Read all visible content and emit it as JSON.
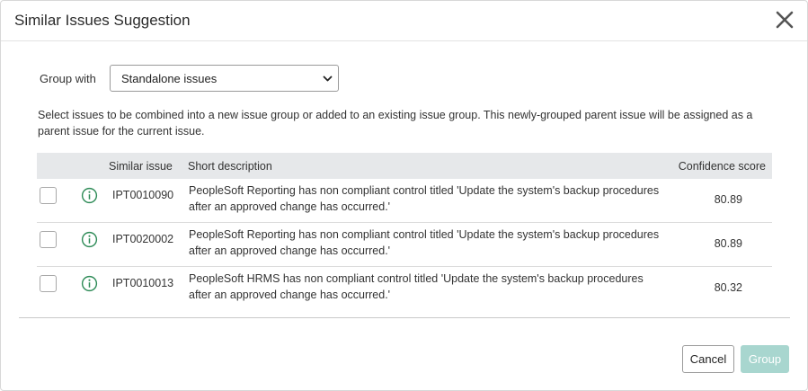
{
  "dialog": {
    "title": "Similar Issues Suggestion"
  },
  "group_with": {
    "label": "Group with",
    "selected": "Standalone issues"
  },
  "description": "Select issues to be combined into a new issue group or added to an existing issue group. This newly-grouped parent issue will be assigned as a parent issue for the current issue.",
  "table": {
    "headers": {
      "similar_issue": "Similar issue",
      "short_description": "Short description",
      "confidence_score": "Confidence score"
    },
    "rows": [
      {
        "id": "IPT0010090",
        "short_description": "PeopleSoft Reporting has non compliant control titled 'Update the system's backup procedures after an approved change has occurred.'",
        "score": "80.89",
        "checked": false
      },
      {
        "id": "IPT0020002",
        "short_description": "PeopleSoft Reporting has non compliant control titled 'Update the system's backup procedures after an approved change has occurred.'",
        "score": "80.89",
        "checked": false
      },
      {
        "id": "IPT0010013",
        "short_description": "PeopleSoft HRMS has non compliant control titled 'Update the system's backup procedures after an approved change has occurred.'",
        "score": "80.32",
        "checked": false
      }
    ]
  },
  "footer": {
    "cancel_label": "Cancel",
    "group_label": "Group"
  },
  "colors": {
    "info_icon": "#2e8b57",
    "group_button_disabled": "#a8d6cf",
    "header_bg": "#e6e8ea"
  },
  "icons": {
    "close": "close-icon",
    "info": "info-icon",
    "dropdown": "chevron-down-icon"
  }
}
